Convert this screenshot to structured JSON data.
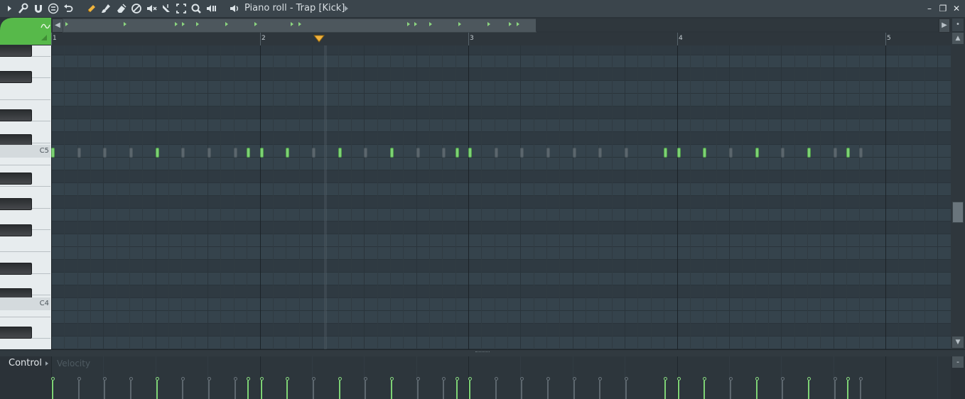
{
  "window": {
    "title": "Piano roll - Trap [Kick]",
    "minimize": "–",
    "restore": "❐",
    "close": "✕"
  },
  "toolbar": {
    "icons": [
      "play-menu-icon",
      "wrench-icon",
      "magnet-icon",
      "stamp-icon",
      "undo-icon",
      "pencil-icon",
      "brush-icon",
      "erase-icon",
      "delete-icon",
      "mute-icon",
      "slice-icon",
      "select-icon",
      "zoom-icon",
      "playback-icon",
      "speaker-icon"
    ]
  },
  "ruler": {
    "bars": [
      "1",
      "2",
      "3",
      "4",
      "5"
    ]
  },
  "keyboard": {
    "labels": {
      "c5": "C5",
      "c4": "C4"
    }
  },
  "control": {
    "label": "Control",
    "parameter": "Velocity"
  },
  "colors": {
    "note_on": "#7dd274",
    "note_off": "#5b666d",
    "grid_bg": "#34414a",
    "accent_green": "#57b94a",
    "playhead": "#f2b23c"
  },
  "notes": {
    "pitch": "C5",
    "steps_per_bar": 16,
    "active_steps": [
      0,
      8,
      15,
      16,
      18,
      22,
      26,
      31,
      32,
      47,
      48,
      50,
      54,
      58,
      61
    ],
    "ghost_steps": [
      2,
      4,
      6,
      10,
      12,
      14,
      20,
      24,
      28,
      30,
      34,
      36,
      38,
      40,
      42,
      44,
      52,
      56,
      60,
      62
    ]
  },
  "playhead_position_bars": 2.28
}
